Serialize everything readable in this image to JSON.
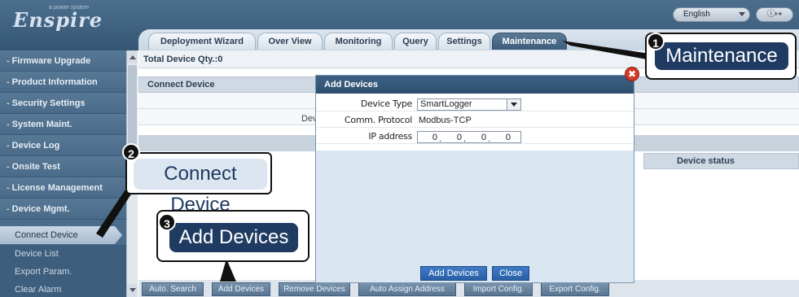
{
  "header": {
    "logo_small": "a power system",
    "logo_text": "Enspire",
    "language": "English",
    "window_controls": "ⓘ↦"
  },
  "tabs": [
    {
      "label": "Deployment Wizard"
    },
    {
      "label": "Over View"
    },
    {
      "label": "Monitoring"
    },
    {
      "label": "Query"
    },
    {
      "label": "Settings"
    },
    {
      "label": "Maintenance"
    }
  ],
  "sidebar": {
    "items": [
      {
        "label": "Firmware Upgrade"
      },
      {
        "label": "Product Information"
      },
      {
        "label": "Security Settings"
      },
      {
        "label": "System Maint."
      },
      {
        "label": "Device Log"
      },
      {
        "label": "Onsite Test"
      },
      {
        "label": "License Management"
      },
      {
        "label": "Device Mgmt."
      }
    ],
    "subitems": [
      {
        "label": "Connect Device"
      },
      {
        "label": "Device List"
      },
      {
        "label": "Export Param."
      },
      {
        "label": "Clear Alarm"
      }
    ]
  },
  "main": {
    "total": "Total Device Qty.:0",
    "grid_header": "Connect Device",
    "device_text": "Dev",
    "status_header": "Device status"
  },
  "bottom_buttons": [
    {
      "label": "Auto. Search"
    },
    {
      "label": "Add Devices"
    },
    {
      "label": "Remove Devices"
    },
    {
      "label": "Auto Assign Address"
    },
    {
      "label": "Import Config."
    },
    {
      "label": "Export Config."
    }
  ],
  "dialog": {
    "title": "Add Devices",
    "close": "✖",
    "device_type_label": "Device Type",
    "device_type_value": "SmartLogger",
    "comm_protocol_label": "Comm. Protocol",
    "comm_protocol_value": "Modbus-TCP",
    "ip_label": "IP address",
    "ip_octets": [
      "0",
      "0",
      "0",
      "0"
    ],
    "ip_dot": ".",
    "add_button": "Add Devices",
    "close_button": "Close"
  },
  "callouts": {
    "one": {
      "badge": "1",
      "label": "Maintenance"
    },
    "two": {
      "badge": "2",
      "label": "Connect Device"
    },
    "three": {
      "badge": "3",
      "label": "Add Devices"
    }
  }
}
